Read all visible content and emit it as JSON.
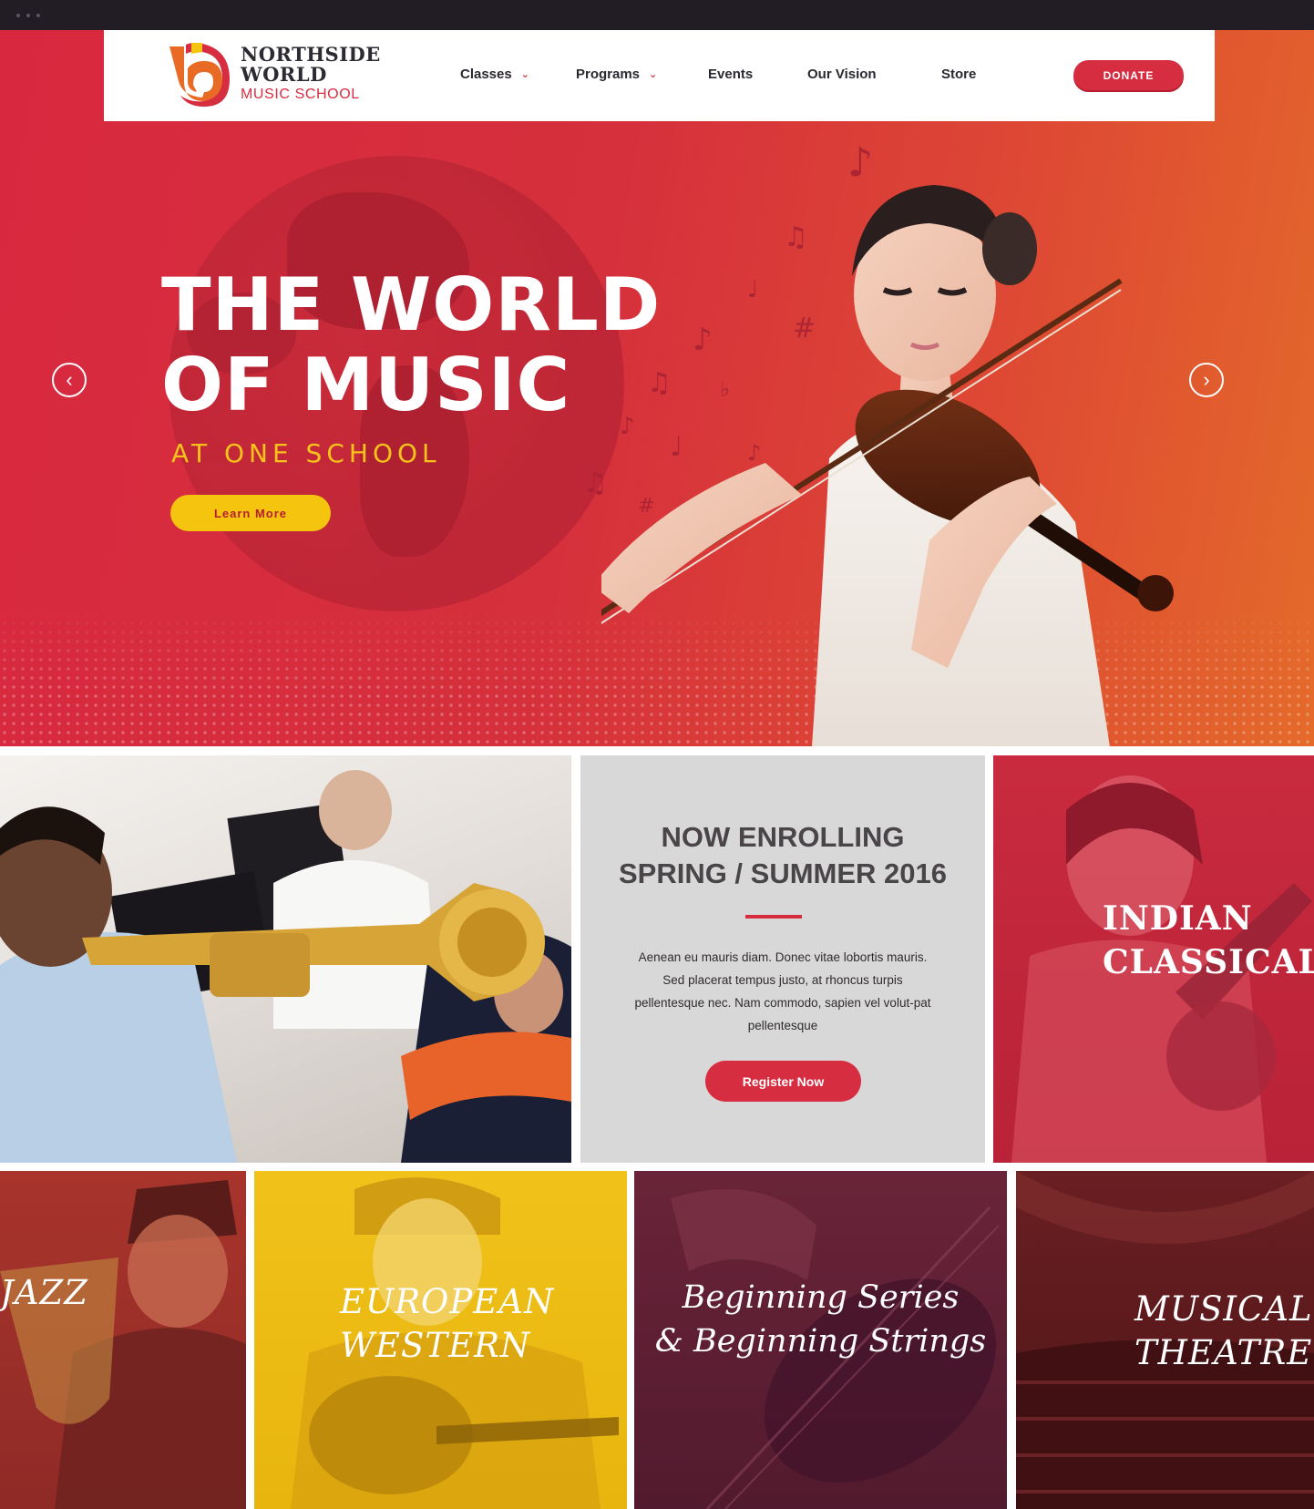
{
  "brand": {
    "line1": "NORTHSIDE",
    "line2": "WORLD",
    "line3": "MUSIC SCHOOL",
    "colors": {
      "primary": "#d62d40",
      "accent": "#f4c40f",
      "dark": "#2c2830",
      "orange": "#e86d21"
    }
  },
  "nav": {
    "items": [
      {
        "label": "Classes",
        "has_dropdown": true
      },
      {
        "label": "Programs",
        "has_dropdown": true
      },
      {
        "label": "Events",
        "has_dropdown": false
      },
      {
        "label": "Our Vision",
        "has_dropdown": false
      },
      {
        "label": "Store",
        "has_dropdown": false
      }
    ],
    "dropdown_icon": "chevron-down-icon",
    "donate_label": "DONATE"
  },
  "hero": {
    "title_line1": "THE WORLD",
    "title_line2": "OF MUSIC",
    "subtitle": "AT ONE SCHOOL",
    "cta_label": "Learn More",
    "prev_icon": "chevron-left-icon",
    "next_icon": "chevron-right-icon"
  },
  "enroll": {
    "title_line1": "NOW ENROLLING",
    "title_line2": "SPRING / SUMMER 2016",
    "body": "Aenean eu mauris diam. Donec vitae lobortis mauris. Sed placerat tempus justo, at rhoncus turpis pellentesque nec. Nam commodo, sapien vel volut-pat pellentesque",
    "cta_label": "Register Now"
  },
  "programs": {
    "indian": {
      "line1": "INDIAN",
      "line2": "CLASSICAL"
    },
    "jazz": {
      "label": "JAZZ"
    },
    "european": {
      "line1": "EUROPEAN",
      "line2": "WESTERN"
    },
    "beginning": {
      "line1": "Beginning Series",
      "line2": "& Beginning Strings"
    },
    "theatre": {
      "line1": "MUSICAL",
      "line2": "THEATRE"
    }
  }
}
